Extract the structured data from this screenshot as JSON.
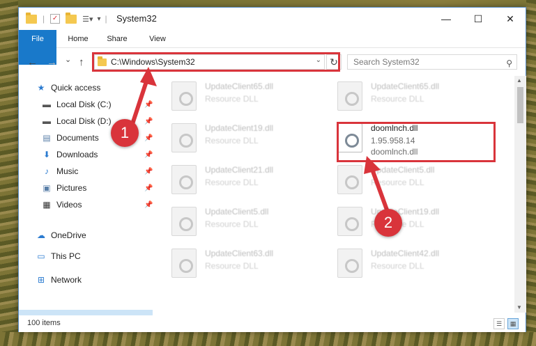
{
  "window": {
    "title": "System32",
    "controls": {
      "minimize": "—",
      "maximize": "☐",
      "close": "✕"
    }
  },
  "ribbon": {
    "tabs": [
      "File",
      "Home",
      "Share",
      "View"
    ]
  },
  "navigation": {
    "back": "←",
    "forward": "→",
    "recent": "⌄",
    "up": "↑",
    "address": "C:\\Windows\\System32",
    "refresh": "↻",
    "search_placeholder": "Search System32",
    "search_icon": "⚲"
  },
  "sidebar": {
    "items": [
      {
        "label": "Quick access",
        "icon": "★",
        "pinned": false
      },
      {
        "label": "Local Disk (C:)",
        "icon": "▬",
        "pinned": true
      },
      {
        "label": "Local Disk (D:)",
        "icon": "▬",
        "pinned": true
      },
      {
        "label": "Documents",
        "icon": "▤",
        "pinned": true
      },
      {
        "label": "Downloads",
        "icon": "⬇",
        "pinned": true
      },
      {
        "label": "Music",
        "icon": "♪",
        "pinned": true
      },
      {
        "label": "Pictures",
        "icon": "▣",
        "pinned": true
      },
      {
        "label": "Videos",
        "icon": "▦",
        "pinned": true
      },
      {
        "label": "OneDrive",
        "icon": "☁",
        "pinned": false
      },
      {
        "label": "This PC",
        "icon": "▭",
        "pinned": false
      },
      {
        "label": "Network",
        "icon": "⊞",
        "pinned": false
      }
    ],
    "pin_glyph": "📌"
  },
  "files": [
    {
      "name": "UpdateClient65.dll",
      "type": "Resource DLL"
    },
    {
      "name": "UpdateClient65.dll",
      "type": "Resource DLL"
    },
    {
      "name": "UpdateClient19.dll",
      "type": "Resource DLL"
    },
    {
      "name": "doomlnch.dll",
      "type": "1.95.958.14",
      "desc": "doomlnch.dll"
    },
    {
      "name": "UpdateClient21.dll",
      "type": "Resource DLL"
    },
    {
      "name": "UpdateClient5.dll",
      "type": "Resource DLL"
    },
    {
      "name": "UpdateClient5.dll",
      "type": "Resource DLL"
    },
    {
      "name": "UpdateClient19.dll",
      "type": "Resource DLL"
    },
    {
      "name": "UpdateClient63.dll",
      "type": "Resource DLL"
    },
    {
      "name": "UpdateClient42.dll",
      "type": "Resource DLL"
    }
  ],
  "status": {
    "item_count": "100 items"
  },
  "annotations": {
    "badge1": "1",
    "badge2": "2",
    "color": "#d9343b"
  }
}
